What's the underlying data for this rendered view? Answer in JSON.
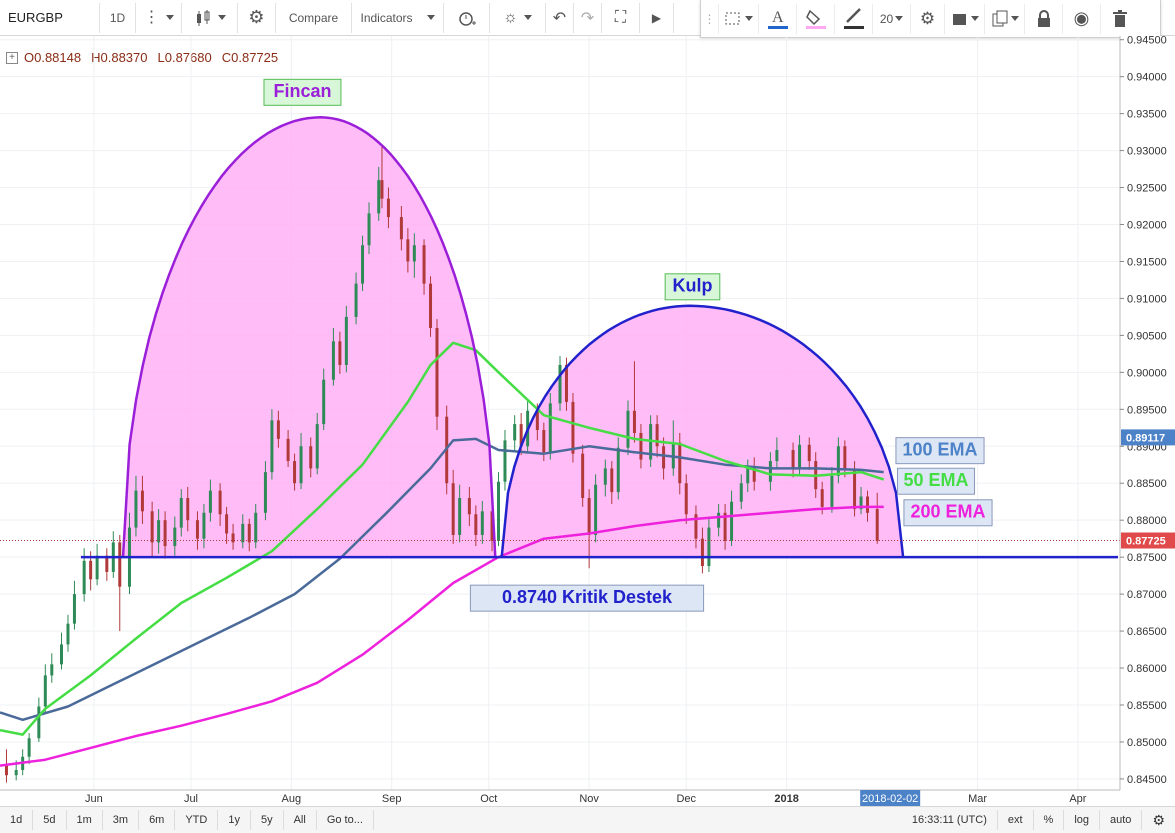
{
  "toolbar": {
    "symbol": "EURGBP",
    "interval": "1D",
    "compare_label": "Compare",
    "indicators_label": "Indicators",
    "font_size": "20"
  },
  "legend": {
    "open": "O0.88148",
    "high": "H0.88370",
    "low": "L0.87680",
    "close": "C0.87725"
  },
  "annotations": {
    "cup": "Fincan",
    "handle": "Kulp",
    "support": "0.8740 Kritik Destek",
    "ema100": "100 EMA",
    "ema50": "50 EMA",
    "ema200": "200 EMA"
  },
  "bottombar": {
    "ranges": [
      "1d",
      "5d",
      "1m",
      "3m",
      "6m",
      "YTD",
      "1y",
      "5y",
      "All",
      "Go to..."
    ],
    "time": "16:33:11 (UTC)",
    "options": [
      "ext",
      "%",
      "log",
      "auto"
    ]
  },
  "colors": {
    "up": "#2e8b57",
    "down": "#b03a3a",
    "ema50": "#44dd44",
    "ema100": "#4a6a9a",
    "ema200": "#ee22dd",
    "cup_stroke": "#9b1fd9",
    "handle_stroke": "#2222cc",
    "fill": "#ffb0f4",
    "support": "#2222cc"
  },
  "chart_data": {
    "type": "candlestick",
    "symbol": "EURGBP",
    "interval": "1D",
    "y_ticks": [
      0.845,
      0.85,
      0.855,
      0.86,
      0.865,
      0.87,
      0.875,
      0.88,
      0.885,
      0.89,
      0.895,
      0.9,
      0.905,
      0.91,
      0.915,
      0.92,
      0.925,
      0.93,
      0.935,
      0.94,
      0.945
    ],
    "y_tick_labels": [
      "0.84500",
      "0.85000",
      "0.85500",
      "0.86000",
      "0.86500",
      "0.87000",
      "0.87500",
      "0.88000",
      "0.88500",
      "0.89000",
      "0.89500",
      "0.90000",
      "0.90500",
      "0.91000",
      "0.91500",
      "0.92000",
      "0.92500",
      "0.93000",
      "0.93500",
      "0.94000",
      "0.94500"
    ],
    "ylim": [
      0.8435,
      0.9455
    ],
    "x_ticks": [
      "Jun",
      "Jul",
      "Aug",
      "Sep",
      "Oct",
      "Nov",
      "Dec",
      "2018",
      "Mar",
      "Apr"
    ],
    "x_tick_dates": [
      "2017-06-01",
      "2017-07-01",
      "2017-08-01",
      "2017-09-01",
      "2017-10-01",
      "2017-11-01",
      "2017-12-01",
      "2018-01-01",
      "2018-03-01",
      "2018-04-01"
    ],
    "xlim": [
      "2017-05-03",
      "2018-04-14"
    ],
    "crosshair_date": "2018-02-02",
    "last_price": 0.87725,
    "last_price_label": "0.87725",
    "ema100_value_label": "0.89117",
    "candles": [
      [
        "2017-05-05",
        0.847,
        0.8455,
        0.849,
        0.8445
      ],
      [
        "2017-05-08",
        0.8455,
        0.8462,
        0.8475,
        0.8448
      ],
      [
        "2017-05-10",
        0.8462,
        0.848,
        0.849,
        0.8455
      ],
      [
        "2017-05-12",
        0.848,
        0.8505,
        0.8512,
        0.847
      ],
      [
        "2017-05-15",
        0.8505,
        0.8548,
        0.856,
        0.85
      ],
      [
        "2017-05-17",
        0.8548,
        0.859,
        0.8605,
        0.854
      ],
      [
        "2017-05-19",
        0.859,
        0.8605,
        0.862,
        0.858
      ],
      [
        "2017-05-22",
        0.8605,
        0.8632,
        0.8648,
        0.8598
      ],
      [
        "2017-05-24",
        0.8632,
        0.866,
        0.8672,
        0.8622
      ],
      [
        "2017-05-26",
        0.866,
        0.87,
        0.8718,
        0.8652
      ],
      [
        "2017-05-29",
        0.87,
        0.8745,
        0.8762,
        0.869
      ],
      [
        "2017-05-31",
        0.8745,
        0.872,
        0.8758,
        0.8705
      ],
      [
        "2017-06-02",
        0.872,
        0.8752,
        0.8768,
        0.8712
      ],
      [
        "2017-06-05",
        0.8752,
        0.873,
        0.8762,
        0.8718
      ],
      [
        "2017-06-07",
        0.873,
        0.877,
        0.8785,
        0.8722
      ],
      [
        "2017-06-09",
        0.877,
        0.871,
        0.878,
        0.865
      ],
      [
        "2017-06-12",
        0.871,
        0.879,
        0.881,
        0.87
      ],
      [
        "2017-06-14",
        0.879,
        0.884,
        0.886,
        0.8778
      ],
      [
        "2017-06-16",
        0.884,
        0.8812,
        0.886,
        0.8795
      ],
      [
        "2017-06-19",
        0.8812,
        0.877,
        0.8825,
        0.875
      ],
      [
        "2017-06-21",
        0.877,
        0.88,
        0.8815,
        0.8755
      ],
      [
        "2017-06-23",
        0.88,
        0.8765,
        0.8812,
        0.8748
      ],
      [
        "2017-06-26",
        0.8765,
        0.879,
        0.8805,
        0.8752
      ],
      [
        "2017-06-28",
        0.879,
        0.883,
        0.8842,
        0.8778
      ],
      [
        "2017-06-30",
        0.883,
        0.88,
        0.8845,
        0.8785
      ],
      [
        "2017-07-03",
        0.88,
        0.8775,
        0.8812,
        0.876
      ],
      [
        "2017-07-05",
        0.8775,
        0.881,
        0.8822,
        0.8762
      ],
      [
        "2017-07-07",
        0.881,
        0.884,
        0.8855,
        0.8798
      ],
      [
        "2017-07-10",
        0.884,
        0.8808,
        0.885,
        0.8792
      ],
      [
        "2017-07-12",
        0.8808,
        0.8782,
        0.8818,
        0.8768
      ],
      [
        "2017-07-14",
        0.8782,
        0.877,
        0.8795,
        0.876
      ],
      [
        "2017-07-17",
        0.877,
        0.8795,
        0.8808,
        0.8762
      ],
      [
        "2017-07-19",
        0.8795,
        0.877,
        0.8802,
        0.8758
      ],
      [
        "2017-07-21",
        0.877,
        0.881,
        0.8822,
        0.8762
      ],
      [
        "2017-07-24",
        0.881,
        0.8865,
        0.888,
        0.88
      ],
      [
        "2017-07-26",
        0.8865,
        0.8935,
        0.895,
        0.8855
      ],
      [
        "2017-07-28",
        0.8935,
        0.891,
        0.8948,
        0.8898
      ],
      [
        "2017-07-31",
        0.891,
        0.888,
        0.8922,
        0.8872
      ],
      [
        "2017-08-02",
        0.888,
        0.885,
        0.889,
        0.884
      ],
      [
        "2017-08-04",
        0.885,
        0.89,
        0.8918,
        0.8842
      ],
      [
        "2017-08-07",
        0.89,
        0.887,
        0.8912,
        0.8858
      ],
      [
        "2017-08-09",
        0.887,
        0.893,
        0.8945,
        0.8862
      ],
      [
        "2017-08-11",
        0.893,
        0.899,
        0.9005,
        0.8922
      ],
      [
        "2017-08-14",
        0.899,
        0.9042,
        0.906,
        0.8982
      ],
      [
        "2017-08-16",
        0.9042,
        0.901,
        0.9055,
        0.8998
      ],
      [
        "2017-08-18",
        0.901,
        0.9075,
        0.909,
        0.9
      ],
      [
        "2017-08-21",
        0.9075,
        0.912,
        0.9135,
        0.9065
      ],
      [
        "2017-08-23",
        0.912,
        0.9172,
        0.9185,
        0.911
      ],
      [
        "2017-08-25",
        0.9172,
        0.9215,
        0.923,
        0.916
      ],
      [
        "2017-08-28",
        0.9215,
        0.926,
        0.9278,
        0.9205
      ],
      [
        "2017-08-29",
        0.926,
        0.9235,
        0.9305,
        0.9222
      ],
      [
        "2017-08-31",
        0.9235,
        0.921,
        0.925,
        0.9195
      ],
      [
        "2017-09-04",
        0.921,
        0.918,
        0.9225,
        0.9165
      ],
      [
        "2017-09-06",
        0.918,
        0.915,
        0.9195,
        0.9135
      ],
      [
        "2017-09-08",
        0.915,
        0.9172,
        0.9188,
        0.9128
      ],
      [
        "2017-09-11",
        0.9172,
        0.912,
        0.918,
        0.9105
      ],
      [
        "2017-09-13",
        0.912,
        0.906,
        0.913,
        0.9048
      ],
      [
        "2017-09-15",
        0.906,
        0.894,
        0.9072,
        0.8922
      ],
      [
        "2017-09-18",
        0.894,
        0.885,
        0.8955,
        0.8835
      ],
      [
        "2017-09-20",
        0.885,
        0.878,
        0.8868,
        0.8768
      ],
      [
        "2017-09-22",
        0.878,
        0.883,
        0.8848,
        0.877
      ],
      [
        "2017-09-25",
        0.883,
        0.8808,
        0.8845,
        0.8792
      ],
      [
        "2017-09-27",
        0.8808,
        0.878,
        0.882,
        0.8765
      ],
      [
        "2017-09-29",
        0.878,
        0.8812,
        0.8826,
        0.8768
      ],
      [
        "2017-10-02",
        0.8812,
        0.8772,
        0.8825,
        0.8758
      ],
      [
        "2017-10-04",
        0.8772,
        0.8852,
        0.8865,
        0.8765
      ],
      [
        "2017-10-06",
        0.8852,
        0.8908,
        0.8922,
        0.884
      ],
      [
        "2017-10-09",
        0.8908,
        0.893,
        0.8942,
        0.8892
      ],
      [
        "2017-10-11",
        0.893,
        0.89,
        0.8945,
        0.8888
      ],
      [
        "2017-10-13",
        0.89,
        0.8948,
        0.8962,
        0.889
      ],
      [
        "2017-10-16",
        0.8948,
        0.8922,
        0.8958,
        0.8908
      ],
      [
        "2017-10-18",
        0.8922,
        0.8892,
        0.8932,
        0.888
      ],
      [
        "2017-10-20",
        0.8892,
        0.8958,
        0.8972,
        0.8882
      ],
      [
        "2017-10-23",
        0.8958,
        0.901,
        0.9022,
        0.8948
      ],
      [
        "2017-10-25",
        0.901,
        0.896,
        0.902,
        0.8948
      ],
      [
        "2017-10-27",
        0.896,
        0.889,
        0.8972,
        0.8878
      ],
      [
        "2017-10-30",
        0.889,
        0.883,
        0.8902,
        0.8818
      ],
      [
        "2017-11-01",
        0.883,
        0.878,
        0.8842,
        0.8735
      ],
      [
        "2017-11-03",
        0.878,
        0.8848,
        0.8862,
        0.877
      ],
      [
        "2017-11-06",
        0.8848,
        0.887,
        0.8882,
        0.8832
      ],
      [
        "2017-11-08",
        0.887,
        0.8838,
        0.888,
        0.8822
      ],
      [
        "2017-11-10",
        0.8838,
        0.8898,
        0.8912,
        0.8828
      ],
      [
        "2017-11-13",
        0.8898,
        0.8948,
        0.8962,
        0.8888
      ],
      [
        "2017-11-15",
        0.8948,
        0.8918,
        0.9015,
        0.8905
      ],
      [
        "2017-11-17",
        0.8918,
        0.8882,
        0.893,
        0.887
      ],
      [
        "2017-11-20",
        0.8882,
        0.893,
        0.8942,
        0.8872
      ],
      [
        "2017-11-22",
        0.893,
        0.89,
        0.8942,
        0.8885
      ],
      [
        "2017-11-24",
        0.89,
        0.887,
        0.8912,
        0.8855
      ],
      [
        "2017-11-27",
        0.887,
        0.8905,
        0.8935,
        0.886
      ],
      [
        "2017-11-29",
        0.8905,
        0.885,
        0.8918,
        0.8835
      ],
      [
        "2017-12-01",
        0.885,
        0.8808,
        0.8862,
        0.8795
      ],
      [
        "2017-12-04",
        0.8808,
        0.8775,
        0.882,
        0.8762
      ],
      [
        "2017-12-06",
        0.8775,
        0.8738,
        0.879,
        0.8728
      ],
      [
        "2017-12-08",
        0.8738,
        0.879,
        0.8805,
        0.873
      ],
      [
        "2017-12-11",
        0.879,
        0.881,
        0.8822,
        0.8778
      ],
      [
        "2017-12-13",
        0.881,
        0.8772,
        0.8822,
        0.876
      ],
      [
        "2017-12-15",
        0.8772,
        0.8825,
        0.884,
        0.8765
      ],
      [
        "2017-12-18",
        0.8825,
        0.885,
        0.8862,
        0.8815
      ],
      [
        "2017-12-20",
        0.885,
        0.8872,
        0.8882,
        0.8838
      ],
      [
        "2017-12-22",
        0.8872,
        0.8852,
        0.8885,
        0.884
      ],
      [
        "2017-12-27",
        0.8852,
        0.888,
        0.8892,
        0.884
      ],
      [
        "2017-12-29",
        0.888,
        0.8895,
        0.8912,
        0.887
      ],
      [
        "2018-01-03",
        0.8895,
        0.887,
        0.8905,
        0.8858
      ],
      [
        "2018-01-05",
        0.887,
        0.8902,
        0.8915,
        0.886
      ],
      [
        "2018-01-08",
        0.8902,
        0.888,
        0.8912,
        0.8868
      ],
      [
        "2018-01-10",
        0.888,
        0.8842,
        0.8892,
        0.883
      ],
      [
        "2018-01-12",
        0.8842,
        0.8818,
        0.8852,
        0.8808
      ],
      [
        "2018-01-15",
        0.8818,
        0.886,
        0.8872,
        0.881
      ],
      [
        "2018-01-17",
        0.886,
        0.89,
        0.8912,
        0.885
      ],
      [
        "2018-01-19",
        0.89,
        0.887,
        0.8908,
        0.8858
      ],
      [
        "2018-01-22",
        0.887,
        0.8815,
        0.888,
        0.8805
      ],
      [
        "2018-01-24",
        0.8815,
        0.8832,
        0.8845,
        0.8808
      ],
      [
        "2018-01-26",
        0.8832,
        0.881,
        0.884,
        0.8798
      ],
      [
        "2018-01-29",
        0.8815,
        0.8772,
        0.8837,
        0.8768
      ]
    ],
    "ema50": [
      [
        "2017-05-03",
        0.8516
      ],
      [
        "2017-05-10",
        0.851
      ],
      [
        "2017-05-17",
        0.8545
      ],
      [
        "2017-05-31",
        0.859
      ],
      [
        "2017-06-14",
        0.864
      ],
      [
        "2017-06-28",
        0.8688
      ],
      [
        "2017-07-12",
        0.8722
      ],
      [
        "2017-07-26",
        0.8758
      ],
      [
        "2017-08-09",
        0.8815
      ],
      [
        "2017-08-23",
        0.8875
      ],
      [
        "2017-09-06",
        0.896
      ],
      [
        "2017-09-13",
        0.901
      ],
      [
        "2017-09-20",
        0.904
      ],
      [
        "2017-09-27",
        0.903
      ],
      [
        "2017-10-04",
        0.9
      ],
      [
        "2017-10-18",
        0.8942
      ],
      [
        "2017-11-01",
        0.8925
      ],
      [
        "2017-11-15",
        0.891
      ],
      [
        "2017-11-29",
        0.8903
      ],
      [
        "2017-12-13",
        0.888
      ],
      [
        "2017-12-27",
        0.8862
      ],
      [
        "2018-01-10",
        0.886
      ],
      [
        "2018-01-24",
        0.8865
      ],
      [
        "2018-01-31",
        0.8855
      ]
    ],
    "ema100": [
      [
        "2017-05-03",
        0.854
      ],
      [
        "2017-05-10",
        0.853
      ],
      [
        "2017-05-24",
        0.8548
      ],
      [
        "2017-06-07",
        0.8578
      ],
      [
        "2017-06-21",
        0.8608
      ],
      [
        "2017-07-05",
        0.8638
      ],
      [
        "2017-07-19",
        0.8668
      ],
      [
        "2017-08-02",
        0.87
      ],
      [
        "2017-08-16",
        0.8748
      ],
      [
        "2017-08-30",
        0.8808
      ],
      [
        "2017-09-13",
        0.887
      ],
      [
        "2017-09-20",
        0.8908
      ],
      [
        "2017-09-27",
        0.891
      ],
      [
        "2017-10-04",
        0.8895
      ],
      [
        "2017-10-18",
        0.889
      ],
      [
        "2017-11-01",
        0.89
      ],
      [
        "2017-11-15",
        0.8892
      ],
      [
        "2017-11-29",
        0.8885
      ],
      [
        "2017-12-13",
        0.8875
      ],
      [
        "2017-12-27",
        0.887
      ],
      [
        "2018-01-10",
        0.887
      ],
      [
        "2018-01-24",
        0.8868
      ],
      [
        "2018-01-31",
        0.8865
      ]
    ],
    "ema200": [
      [
        "2017-05-03",
        0.8468
      ],
      [
        "2017-05-17",
        0.8476
      ],
      [
        "2017-05-31",
        0.8492
      ],
      [
        "2017-06-14",
        0.8508
      ],
      [
        "2017-06-28",
        0.8522
      ],
      [
        "2017-07-12",
        0.8538
      ],
      [
        "2017-07-26",
        0.8555
      ],
      [
        "2017-08-09",
        0.858
      ],
      [
        "2017-08-23",
        0.8618
      ],
      [
        "2017-09-06",
        0.8665
      ],
      [
        "2017-09-20",
        0.8715
      ],
      [
        "2017-10-04",
        0.875
      ],
      [
        "2017-10-18",
        0.8775
      ],
      [
        "2017-11-01",
        0.8782
      ],
      [
        "2017-11-15",
        0.8792
      ],
      [
        "2017-11-29",
        0.88
      ],
      [
        "2017-12-13",
        0.8805
      ],
      [
        "2017-12-27",
        0.881
      ],
      [
        "2018-01-10",
        0.8815
      ],
      [
        "2018-01-24",
        0.8818
      ],
      [
        "2018-01-31",
        0.8818
      ]
    ],
    "support_level": 0.875,
    "cup": {
      "start": "2017-06-10",
      "end": "2017-10-03",
      "peak": "2017-08-10",
      "peak_price": 0.9345,
      "base_price": 0.875
    },
    "handle": {
      "start": "2017-10-05",
      "end": "2018-02-06",
      "peak": "2017-12-02",
      "peak_price": 0.909,
      "base_price": 0.875
    }
  }
}
